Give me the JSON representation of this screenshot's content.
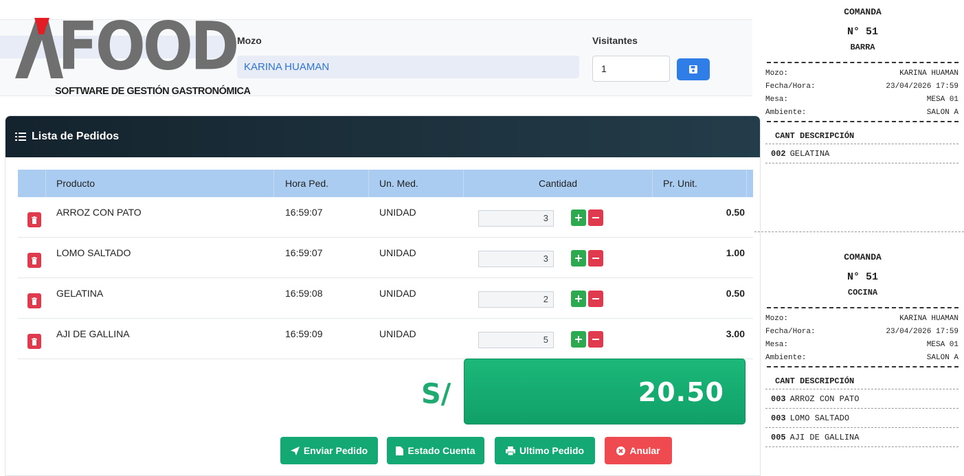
{
  "brand": {
    "logo_letter": "A",
    "logo_word": "FOOD",
    "subtitle": "SOFTWARE DE GESTIÓN GASTRONÓMICA"
  },
  "header": {
    "mozo_label": "Mozo",
    "mozo_value": "KARINA HUAMAN",
    "visitantes_label": "Visitantes",
    "visitantes_value": "1",
    "save_icon": "floppy-icon"
  },
  "orders": {
    "title": "Lista de Pedidos",
    "columns": [
      "Producto",
      "Hora Ped.",
      "Un. Med.",
      "Cantidad",
      "Pr. Unit."
    ],
    "rows": [
      {
        "producto": "ARROZ CON PATO",
        "hora": "16:59:07",
        "unidad": "UNIDAD",
        "cantidad": "3",
        "precio": "0.50"
      },
      {
        "producto": "LOMO SALTADO",
        "hora": "16:59:07",
        "unidad": "UNIDAD",
        "cantidad": "3",
        "precio": "1.00"
      },
      {
        "producto": "GELATINA",
        "hora": "16:59:08",
        "unidad": "UNIDAD",
        "cantidad": "2",
        "precio": "0.50"
      },
      {
        "producto": "AJI DE GALLINA",
        "hora": "16:59:09",
        "unidad": "UNIDAD",
        "cantidad": "5",
        "precio": "3.00"
      }
    ],
    "currency": "S/",
    "total": "20.50"
  },
  "actions": {
    "send": "Enviar Pedido",
    "account": "Estado Cuenta",
    "last": "Ultimo Pedido",
    "cancel": "Anular"
  },
  "receipts": [
    {
      "title": "COMANDA",
      "number": "N° 51",
      "area": "BARRA",
      "lines": [
        {
          "k": "Mozo:",
          "v": "KARINA HUAMAN"
        },
        {
          "k": "Fecha/Hora:",
          "v": "23/04/2026 17:59"
        },
        {
          "k": "Mesa:",
          "v": "MESA 01"
        },
        {
          "k": "Ambiente:",
          "v": "SALON A"
        }
      ],
      "header": "CANT DESCRIPCIÓN",
      "items": [
        {
          "cant": "002",
          "desc": "GELATINA"
        }
      ]
    },
    {
      "title": "COMANDA",
      "number": "N° 51",
      "area": "COCINA",
      "lines": [
        {
          "k": "Mozo:",
          "v": "KARINA HUAMAN"
        },
        {
          "k": "Fecha/Hora:",
          "v": "23/04/2026 17:59"
        },
        {
          "k": "Mesa:",
          "v": "MESA 01"
        },
        {
          "k": "Ambiente:",
          "v": "SALON A"
        }
      ],
      "header": "CANT DESCRIPCIÓN",
      "items": [
        {
          "cant": "003",
          "desc": "ARROZ CON PATO"
        },
        {
          "cant": "003",
          "desc": "LOMO SALTADO"
        },
        {
          "cant": "005",
          "desc": "AJI DE GALLINA"
        }
      ]
    }
  ]
}
